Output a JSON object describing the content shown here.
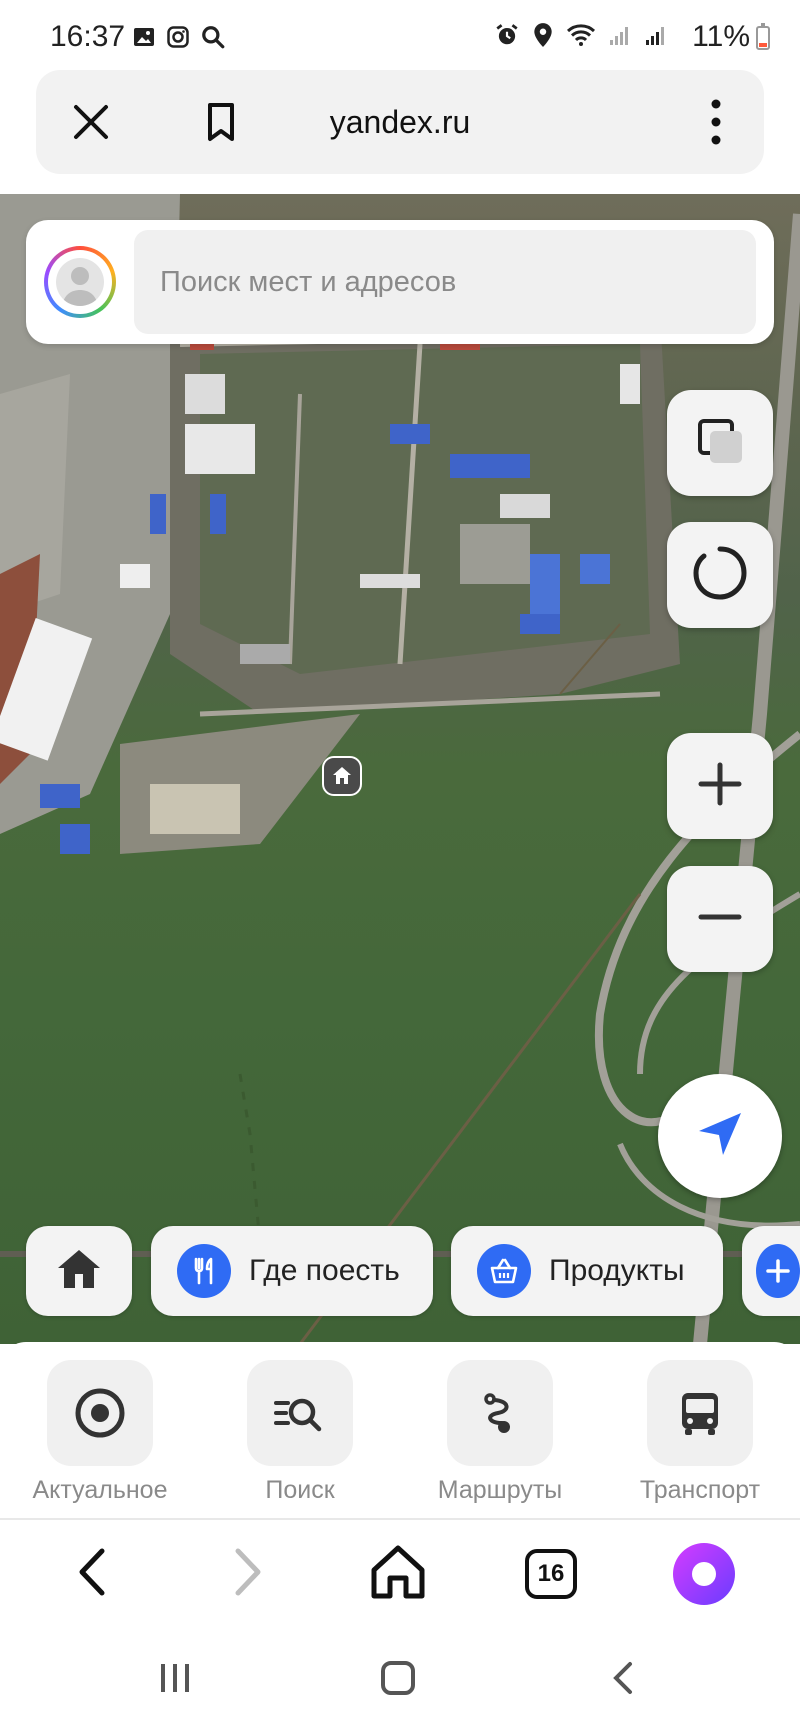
{
  "status_bar": {
    "time": "16:37",
    "battery": "11%",
    "left_icons": [
      "image-icon",
      "instagram-icon",
      "search-icon"
    ],
    "right_icons": [
      "alarm-icon",
      "location-icon",
      "wifi-icon",
      "signal-icon",
      "signal-icon",
      "battery-icon"
    ]
  },
  "browser": {
    "url": "yandex.ru",
    "tab_count": "16"
  },
  "search": {
    "placeholder": "Поиск мест и адресов"
  },
  "map_controls": [
    "layers-icon",
    "alice-ring-icon",
    "zoom-in-icon",
    "zoom-out-icon",
    "locate-arrow-icon"
  ],
  "chips": {
    "home": {
      "icon": "home-icon"
    },
    "eat": {
      "label": "Где поесть",
      "icon": "fork-knife-icon"
    },
    "products": {
      "label": "Продукты",
      "icon": "basket-icon"
    }
  },
  "bottom_nav": {
    "items": [
      {
        "label": "Актуальное",
        "icon": "target-icon"
      },
      {
        "label": "Поиск",
        "icon": "list-search-icon"
      },
      {
        "label": "Маршруты",
        "icon": "route-icon"
      },
      {
        "label": "Транспорт",
        "icon": "bus-icon"
      }
    ]
  },
  "colors": {
    "accent": "#2f6bf4",
    "alice_start": "#d53cff",
    "alice_end": "#6a3cff"
  }
}
